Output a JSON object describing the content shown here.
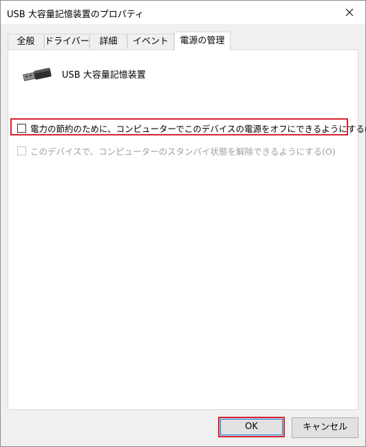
{
  "window": {
    "title": "USB 大容量記憶装置のプロパティ",
    "close_icon": "close-icon"
  },
  "tabs": [
    {
      "label": "全般",
      "active": false
    },
    {
      "label": "ドライバー",
      "active": false
    },
    {
      "label": "詳細",
      "active": false
    },
    {
      "label": "イベント",
      "active": false
    },
    {
      "label": "電源の管理",
      "active": true
    }
  ],
  "device": {
    "icon": "usb-connector-icon",
    "name": "USB 大容量記憶装置"
  },
  "options": {
    "allow_power_off": {
      "label": "電力の節約のために、コンピューターでこのデバイスの電源をオフにできるようにする(A)",
      "checked": false,
      "enabled": true,
      "highlight_color": "#d8222f"
    },
    "allow_wake": {
      "label": "このデバイスで、コンピューターのスタンバイ状態を解除できるようにする(O)",
      "checked": false,
      "enabled": false
    }
  },
  "buttons": {
    "ok": "OK",
    "cancel": "キャンセル"
  },
  "colors": {
    "highlight": "#d8222f",
    "focus": "#0078d7"
  }
}
